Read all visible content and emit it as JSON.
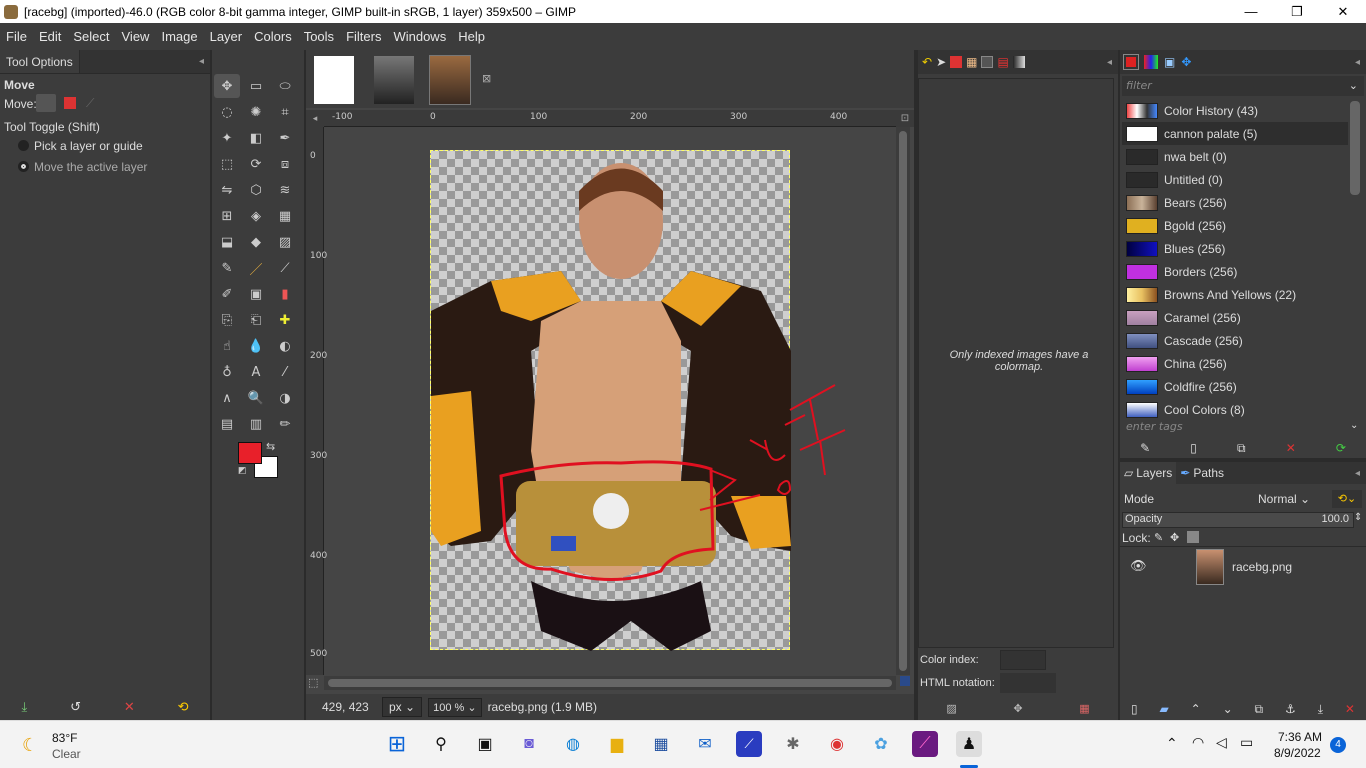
{
  "window": {
    "title": "[racebg] (imported)-46.0 (RGB color 8-bit gamma integer, GIMP built-in sRGB, 1 layer) 359x500 – GIMP",
    "minimize": "—",
    "maximize": "❐",
    "close": "✕"
  },
  "menu": [
    "File",
    "Edit",
    "Select",
    "View",
    "Image",
    "Layer",
    "Colors",
    "Tools",
    "Filters",
    "Windows",
    "Help"
  ],
  "tool_options": {
    "tab": "Tool Options",
    "tool_name": "Move",
    "move_label": "Move:",
    "toggle_label": "Tool Toggle  (Shift)",
    "radio1": "Pick a layer or guide",
    "radio2": "Move the active layer"
  },
  "canvas": {
    "ruler_h": [
      "-100",
      "0",
      "100",
      "200",
      "300",
      "400"
    ],
    "ruler_v": [
      "0",
      "100",
      "200",
      "300",
      "400",
      "500"
    ],
    "status_coords": "429, 423",
    "unit": "px",
    "zoom": "100 %",
    "status_file": "racebg.png (1.9 MB)"
  },
  "colormap": {
    "message": "Only indexed images have a colormap.",
    "color_index_label": "Color index:",
    "html_notation_label": "HTML notation:"
  },
  "palettes": {
    "filter_placeholder": "filter",
    "tags_placeholder": "enter tags",
    "items": [
      {
        "label": "Color History (43)",
        "color": "#d04040"
      },
      {
        "label": "cannon palate (5)",
        "color": "#ffffff"
      },
      {
        "label": "nwa belt (0)",
        "color": "#2a2a2a"
      },
      {
        "label": "Untitled (0)",
        "color": "#2a2a2a"
      },
      {
        "label": "Bears (256)",
        "color": "#8c6f55"
      },
      {
        "label": "Bgold (256)",
        "color": "#e0b020"
      },
      {
        "label": "Blues (256)",
        "color": "#101080"
      },
      {
        "label": "Borders (256)",
        "color": "#c030e0"
      },
      {
        "label": "Browns And Yellows (22)",
        "color": "#e8c060"
      },
      {
        "label": "Caramel (256)",
        "color": "#c8a0c0"
      },
      {
        "label": "Cascade (256)",
        "color": "#6070a0"
      },
      {
        "label": "China (256)",
        "color": "#d060e0"
      },
      {
        "label": "Coldfire (256)",
        "color": "#1070e0"
      },
      {
        "label": "Cool Colors (8)",
        "color": "#4060c0"
      }
    ]
  },
  "layers": {
    "tab_layers": "Layers",
    "tab_paths": "Paths",
    "mode_label": "Mode",
    "mode_value": "Normal",
    "opacity_label": "Opacity",
    "opacity_value": "100.0",
    "lock_label": "Lock:",
    "layer_name": "racebg.png"
  },
  "taskbar": {
    "weather_temp": "83°F",
    "weather_desc": "Clear",
    "time": "7:36 AM",
    "date": "8/9/2022",
    "notifications": "4"
  }
}
